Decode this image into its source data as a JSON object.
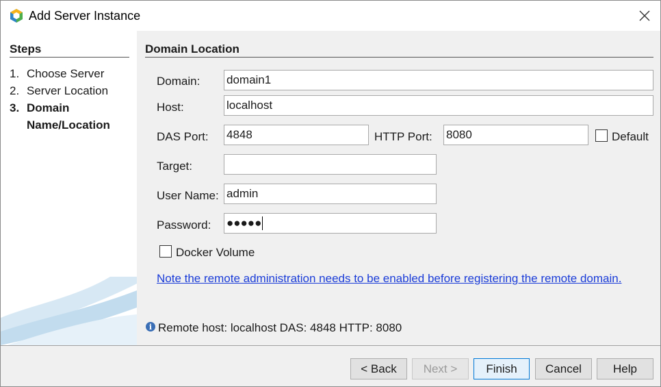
{
  "window": {
    "title": "Add Server Instance"
  },
  "steps": {
    "header": "Steps",
    "items": [
      {
        "num": "1.",
        "label": "Choose Server"
      },
      {
        "num": "2.",
        "label": "Server Location"
      },
      {
        "num": "3.",
        "label": "Domain",
        "label_cont": "Name/Location"
      }
    ]
  },
  "panel": {
    "title": "Domain Location",
    "domain": {
      "label": "Domain:",
      "value": "domain1"
    },
    "host": {
      "label": "Host:",
      "value": "localhost"
    },
    "das_port": {
      "label": "DAS Port:",
      "value": "4848"
    },
    "http_port": {
      "label": "HTTP Port:",
      "value": "8080"
    },
    "default_checkbox": {
      "label": "Default",
      "checked": false
    },
    "target": {
      "label": "Target:",
      "value": ""
    },
    "user_name": {
      "label": "User Name:",
      "value": "admin"
    },
    "password": {
      "label": "Password:",
      "value": "●●●●●"
    },
    "docker_volume": {
      "label": "Docker Volume",
      "checked": false
    },
    "note_link": "Note the remote administration needs to be enabled before registering the remote domain.",
    "status_text": "Remote host: localhost DAS: 4848 HTTP: 8080",
    "status_icon": "info-icon"
  },
  "buttons": {
    "back": "< Back",
    "next": "Next >",
    "finish": "Finish",
    "cancel": "Cancel",
    "help": "Help"
  },
  "colors": {
    "link": "#1a3cd8",
    "accent": "#0078d7"
  }
}
